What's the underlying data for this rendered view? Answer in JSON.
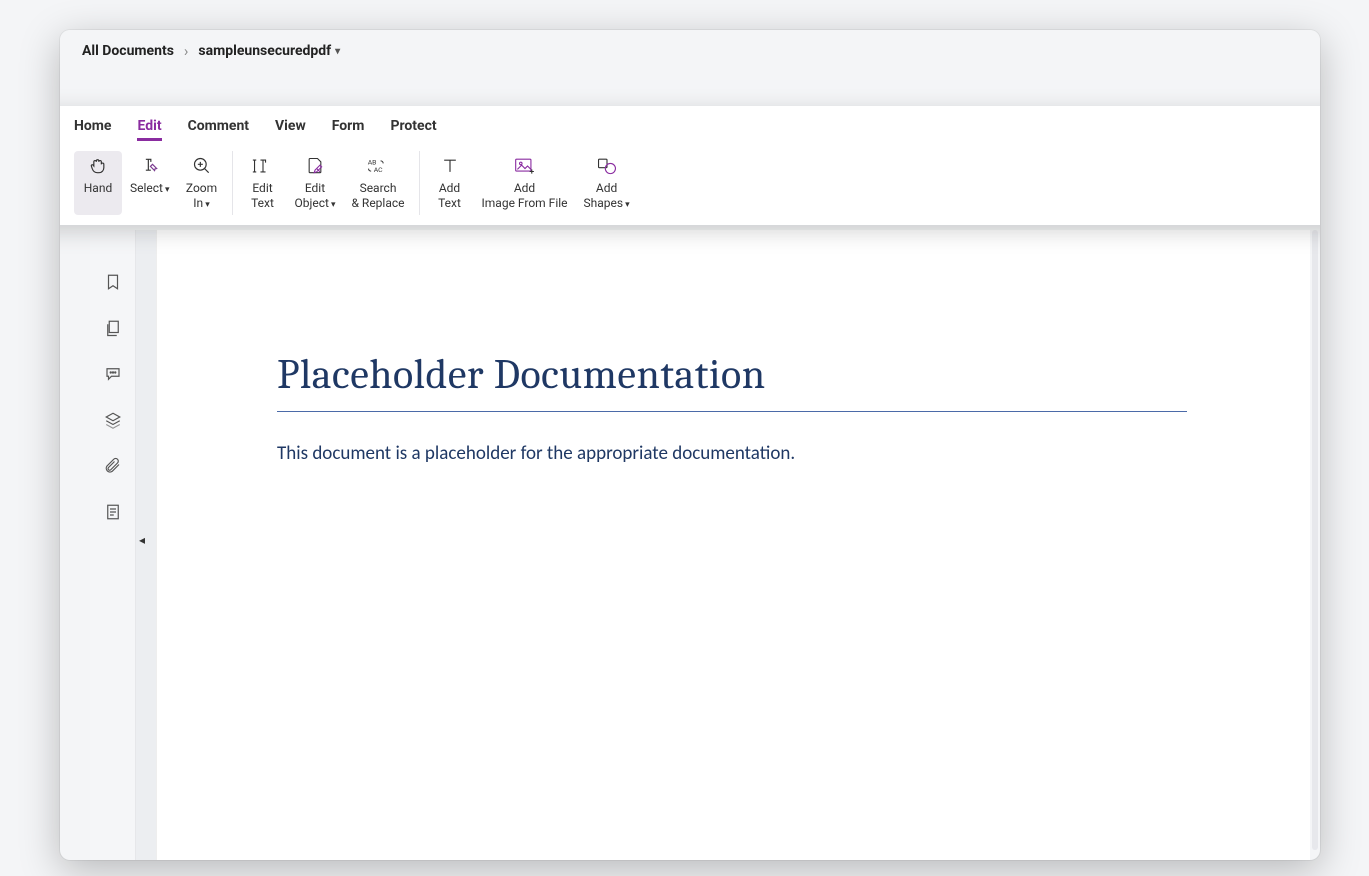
{
  "breadcrumb": {
    "root": "All Documents",
    "doc": "sampleunsecuredpdf"
  },
  "menu": {
    "tabs": [
      "Home",
      "Edit",
      "Comment",
      "View",
      "Form",
      "Protect"
    ],
    "active": "Edit"
  },
  "toolbar": {
    "hand": "Hand",
    "select": "Select",
    "zoom_in": "Zoom\nIn",
    "edit_text": "Edit\nText",
    "edit_object": "Edit\nObject",
    "search_replace": "Search\n& Replace",
    "add_text": "Add\nText",
    "add_image": "Add\nImage From File",
    "add_shapes": "Add\nShapes"
  },
  "sidebar_icons": [
    "bookmark",
    "pages",
    "comments",
    "layers",
    "attachment",
    "form-data"
  ],
  "document": {
    "title": "Placeholder Documentation",
    "body": "This document is a placeholder for the appropriate documentation."
  }
}
